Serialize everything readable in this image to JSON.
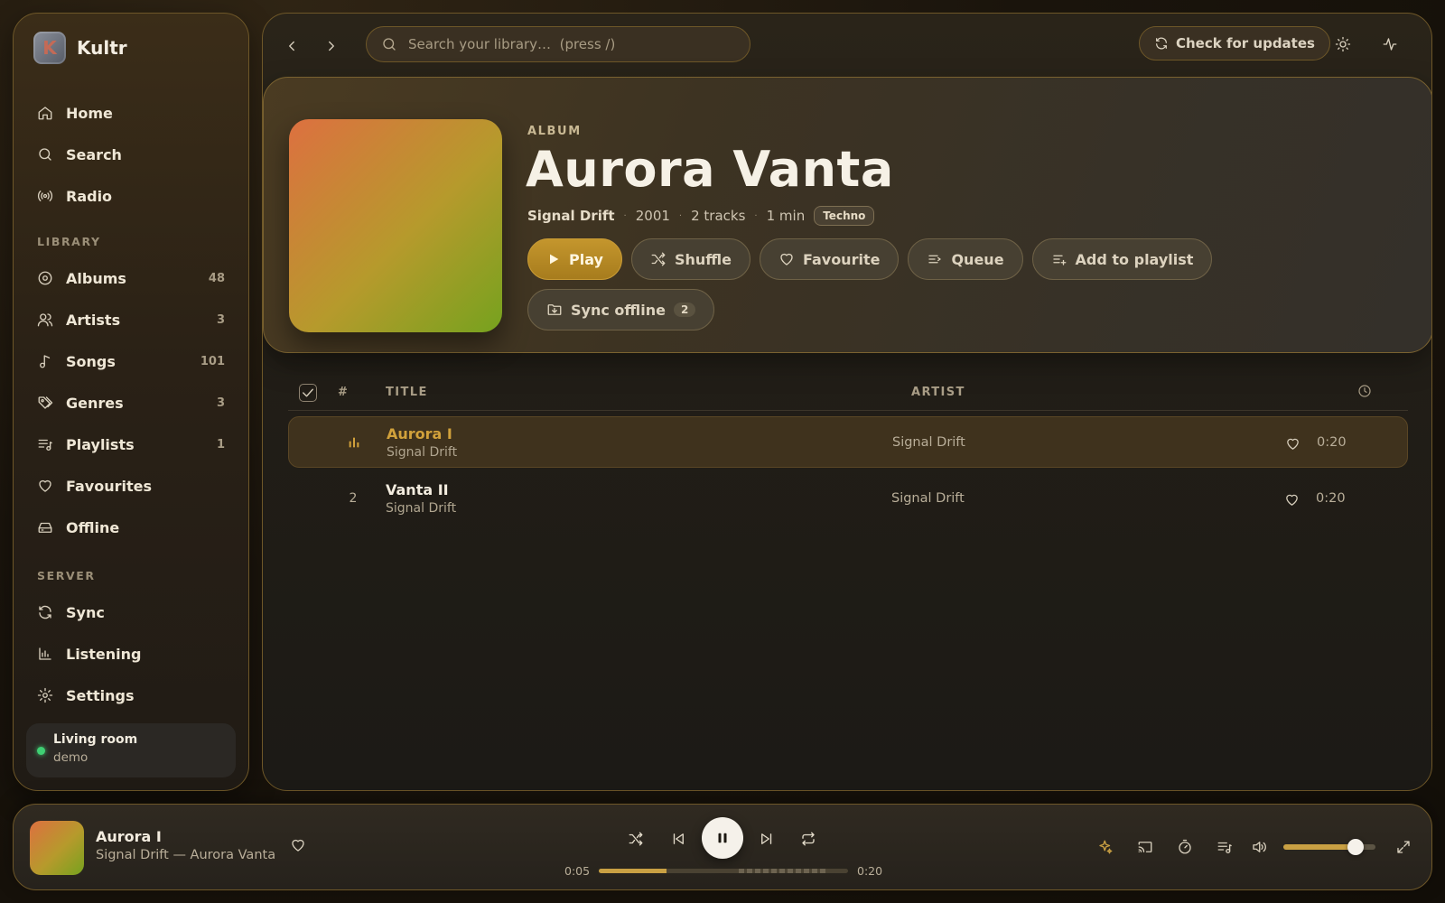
{
  "app": {
    "name": "Kultr",
    "logo_letter": "K"
  },
  "sidebar": {
    "main_items": [
      {
        "label": "Home",
        "icon": "home-icon"
      },
      {
        "label": "Search",
        "icon": "search-icon"
      },
      {
        "label": "Radio",
        "icon": "radio-icon"
      }
    ],
    "library_title": "LIBRARY",
    "library_items": [
      {
        "label": "Albums",
        "count": "48",
        "icon": "album-icon"
      },
      {
        "label": "Artists",
        "count": "3",
        "icon": "users-icon"
      },
      {
        "label": "Songs",
        "count": "101",
        "icon": "music-note-icon"
      },
      {
        "label": "Genres",
        "count": "3",
        "icon": "tags-icon"
      },
      {
        "label": "Playlists",
        "count": "1",
        "icon": "playlist-icon"
      },
      {
        "label": "Favourites",
        "count": "",
        "icon": "heart-icon"
      },
      {
        "label": "Offline",
        "count": "",
        "icon": "drive-icon"
      }
    ],
    "server_title": "SERVER",
    "server_items": [
      {
        "label": "Sync",
        "icon": "sync-icon"
      },
      {
        "label": "Listening",
        "icon": "chart-icon"
      },
      {
        "label": "Settings",
        "icon": "gear-icon"
      }
    ],
    "device": {
      "name": "Living room",
      "user": "demo",
      "status_color": "#3fcf73"
    }
  },
  "topbar": {
    "search_placeholder": "Search your library…  (press /)",
    "check_updates": "Check for updates"
  },
  "album": {
    "label": "ALBUM",
    "title": "Aurora Vanta",
    "artist": "Signal Drift",
    "year": "2001",
    "tracks": "2 tracks",
    "duration": "1 min",
    "genre": "Techno",
    "actions": {
      "play": "Play",
      "shuffle": "Shuffle",
      "favourite": "Favourite",
      "queue": "Queue",
      "add_to_playlist": "Add to playlist",
      "sync_offline": "Sync offline",
      "sync_offline_count": "2"
    }
  },
  "tracklist": {
    "headers": {
      "num": "#",
      "title": "TITLE",
      "artist": "ARTIST"
    },
    "rows": [
      {
        "num": "",
        "title": "Aurora I",
        "subtitle": "Signal Drift",
        "artist": "Signal Drift",
        "duration": "0:20",
        "playing": true
      },
      {
        "num": "2",
        "title": "Vanta II",
        "subtitle": "Signal Drift",
        "artist": "Signal Drift",
        "duration": "0:20",
        "playing": false
      }
    ]
  },
  "player": {
    "title": "Aurora I",
    "subtitle": "Signal Drift — Aurora Vanta",
    "elapsed": "0:05",
    "total": "0:20",
    "progress_fraction": 0.27,
    "buffered_from": 0.56,
    "buffered_to": 0.92,
    "volume_fraction": 0.78
  },
  "colors": {
    "accent": "#c9a043",
    "online": "#3fcf73"
  }
}
